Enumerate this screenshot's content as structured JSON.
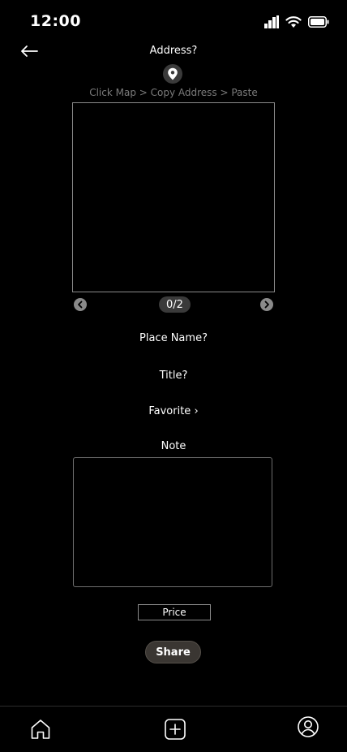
{
  "status": {
    "time": "12:00"
  },
  "header": {
    "title": "Address?",
    "hint": "Click Map > Copy Address > Paste"
  },
  "gallery": {
    "counter": "0/2"
  },
  "form": {
    "place_name": "Place Name?",
    "title": "Title?",
    "favorite": "Favorite ›",
    "note_label": "Note",
    "price": "Price"
  },
  "actions": {
    "share": "Share"
  },
  "tabbar": {
    "items": [
      "home-icon",
      "add-icon",
      "profile-icon"
    ]
  }
}
